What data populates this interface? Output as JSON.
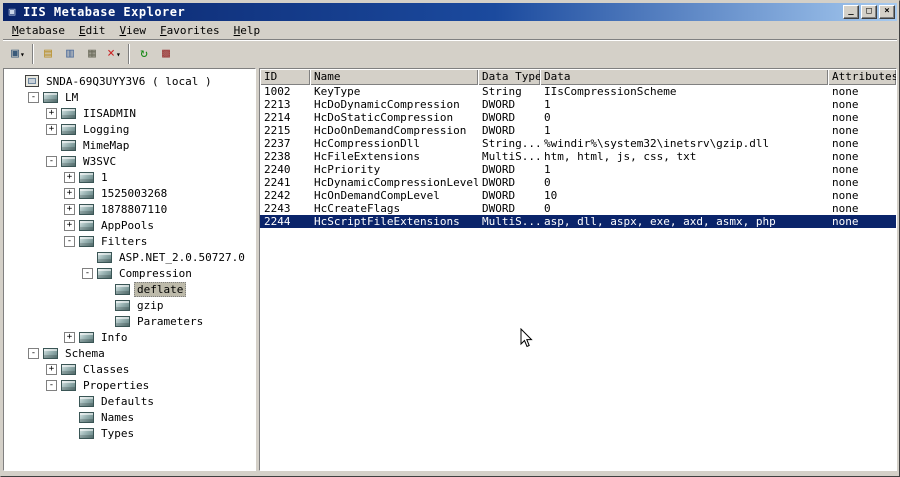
{
  "window": {
    "title": "IIS Metabase Explorer",
    "controls": {
      "minimize": "_",
      "maximize": "□",
      "close": "×"
    }
  },
  "menu": {
    "items": [
      {
        "label": "Metabase"
      },
      {
        "label": "Edit"
      },
      {
        "label": "View"
      },
      {
        "label": "Favorites"
      },
      {
        "label": "Help"
      }
    ]
  },
  "toolbar": {
    "buttons": [
      {
        "name": "connect-button",
        "icon": "computer-icon",
        "glyph": "▣",
        "color": "#3a5a7a",
        "dropdown": true
      },
      {
        "sep": true
      },
      {
        "name": "new-key-button",
        "icon": "new-key-icon",
        "glyph": "▤",
        "color": "#b8902a"
      },
      {
        "name": "copy-button",
        "icon": "copy-icon",
        "glyph": "▥",
        "color": "#4a6a9a"
      },
      {
        "name": "paste-button",
        "icon": "paste-icon",
        "glyph": "▦",
        "color": "#6a6a5a"
      },
      {
        "name": "delete-button",
        "icon": "delete-icon",
        "glyph": "×",
        "color": "#cc2222",
        "dropdown": true
      },
      {
        "sep": true
      },
      {
        "name": "refresh-button",
        "icon": "refresh-icon",
        "glyph": "↻",
        "color": "#118811"
      },
      {
        "name": "hierarchy-button",
        "icon": "hierarchy-icon",
        "glyph": "▩",
        "color": "#993333"
      }
    ]
  },
  "tree": {
    "items": [
      {
        "label": "SNDA-69Q3UYY3V6 ( local )",
        "level": 0,
        "expand": "none",
        "icon": "computer-icon"
      },
      {
        "label": "LM",
        "level": 1,
        "expand": "minus",
        "icon": "metabase-key-icon"
      },
      {
        "label": "IISADMIN",
        "level": 2,
        "expand": "plus",
        "icon": "metabase-key-icon"
      },
      {
        "label": "Logging",
        "level": 2,
        "expand": "plus",
        "icon": "metabase-key-icon"
      },
      {
        "label": "MimeMap",
        "level": 2,
        "expand": "none",
        "icon": "metabase-key-icon"
      },
      {
        "label": "W3SVC",
        "level": 2,
        "expand": "minus",
        "icon": "metabase-key-icon"
      },
      {
        "label": "1",
        "level": 3,
        "expand": "plus",
        "icon": "metabase-key-icon"
      },
      {
        "label": "1525003268",
        "level": 3,
        "expand": "plus",
        "icon": "metabase-key-icon"
      },
      {
        "label": "1878807110",
        "level": 3,
        "expand": "plus",
        "icon": "metabase-key-icon"
      },
      {
        "label": "AppPools",
        "level": 3,
        "expand": "plus",
        "icon": "metabase-key-icon"
      },
      {
        "label": "Filters",
        "level": 3,
        "expand": "minus",
        "icon": "metabase-key-icon"
      },
      {
        "label": "ASP.NET_2.0.50727.0",
        "level": 4,
        "expand": "none",
        "icon": "metabase-key-icon"
      },
      {
        "label": "Compression",
        "level": 4,
        "expand": "minus",
        "icon": "metabase-key-icon"
      },
      {
        "label": "deflate",
        "level": 5,
        "expand": "none",
        "icon": "metabase-key-icon",
        "selected": true
      },
      {
        "label": "gzip",
        "level": 5,
        "expand": "none",
        "icon": "metabase-key-icon"
      },
      {
        "label": "Parameters",
        "level": 5,
        "expand": "none",
        "icon": "metabase-key-icon"
      },
      {
        "label": "Info",
        "level": 3,
        "expand": "plus",
        "icon": "metabase-key-icon"
      },
      {
        "label": "Schema",
        "level": 1,
        "expand": "minus",
        "icon": "metabase-key-icon"
      },
      {
        "label": "Classes",
        "level": 2,
        "expand": "plus",
        "icon": "metabase-key-icon"
      },
      {
        "label": "Properties",
        "level": 2,
        "expand": "minus",
        "icon": "metabase-key-icon"
      },
      {
        "label": "Defaults",
        "level": 3,
        "expand": "none",
        "icon": "metabase-key-icon"
      },
      {
        "label": "Names",
        "level": 3,
        "expand": "none",
        "icon": "metabase-key-icon"
      },
      {
        "label": "Types",
        "level": 3,
        "expand": "none",
        "icon": "metabase-key-icon"
      }
    ]
  },
  "table": {
    "columns": [
      "ID",
      "Name",
      "Data Type",
      "Data",
      "Attributes"
    ],
    "rows": [
      {
        "id": "1002",
        "name": "KeyType",
        "type": "String",
        "data": "IIsCompressionScheme",
        "attributes": "none"
      },
      {
        "id": "2213",
        "name": "HcDoDynamicCompression",
        "type": "DWORD",
        "data": "1",
        "attributes": "none"
      },
      {
        "id": "2214",
        "name": "HcDoStaticCompression",
        "type": "DWORD",
        "data": "0",
        "attributes": "none"
      },
      {
        "id": "2215",
        "name": "HcDoOnDemandCompression",
        "type": "DWORD",
        "data": "1",
        "attributes": "none"
      },
      {
        "id": "2237",
        "name": "HcCompressionDll",
        "type": "String...",
        "data": "%windir%\\system32\\inetsrv\\gzip.dll",
        "attributes": "none"
      },
      {
        "id": "2238",
        "name": "HcFileExtensions",
        "type": "MultiS...",
        "data": "htm, html, js, css, txt",
        "attributes": "none"
      },
      {
        "id": "2240",
        "name": "HcPriority",
        "type": "DWORD",
        "data": "1",
        "attributes": "none"
      },
      {
        "id": "2241",
        "name": "HcDynamicCompressionLevel",
        "type": "DWORD",
        "data": "0",
        "attributes": "none"
      },
      {
        "id": "2242",
        "name": "HcOnDemandCompLevel",
        "type": "DWORD",
        "data": "10",
        "attributes": "none"
      },
      {
        "id": "2243",
        "name": "HcCreateFlags",
        "type": "DWORD",
        "data": "0",
        "attributes": "none"
      },
      {
        "id": "2244",
        "name": "HcScriptFileExtensions",
        "type": "MultiS...",
        "data": "asp, dll, aspx, exe, axd, asmx, php",
        "attributes": "none",
        "selected": true
      }
    ]
  }
}
